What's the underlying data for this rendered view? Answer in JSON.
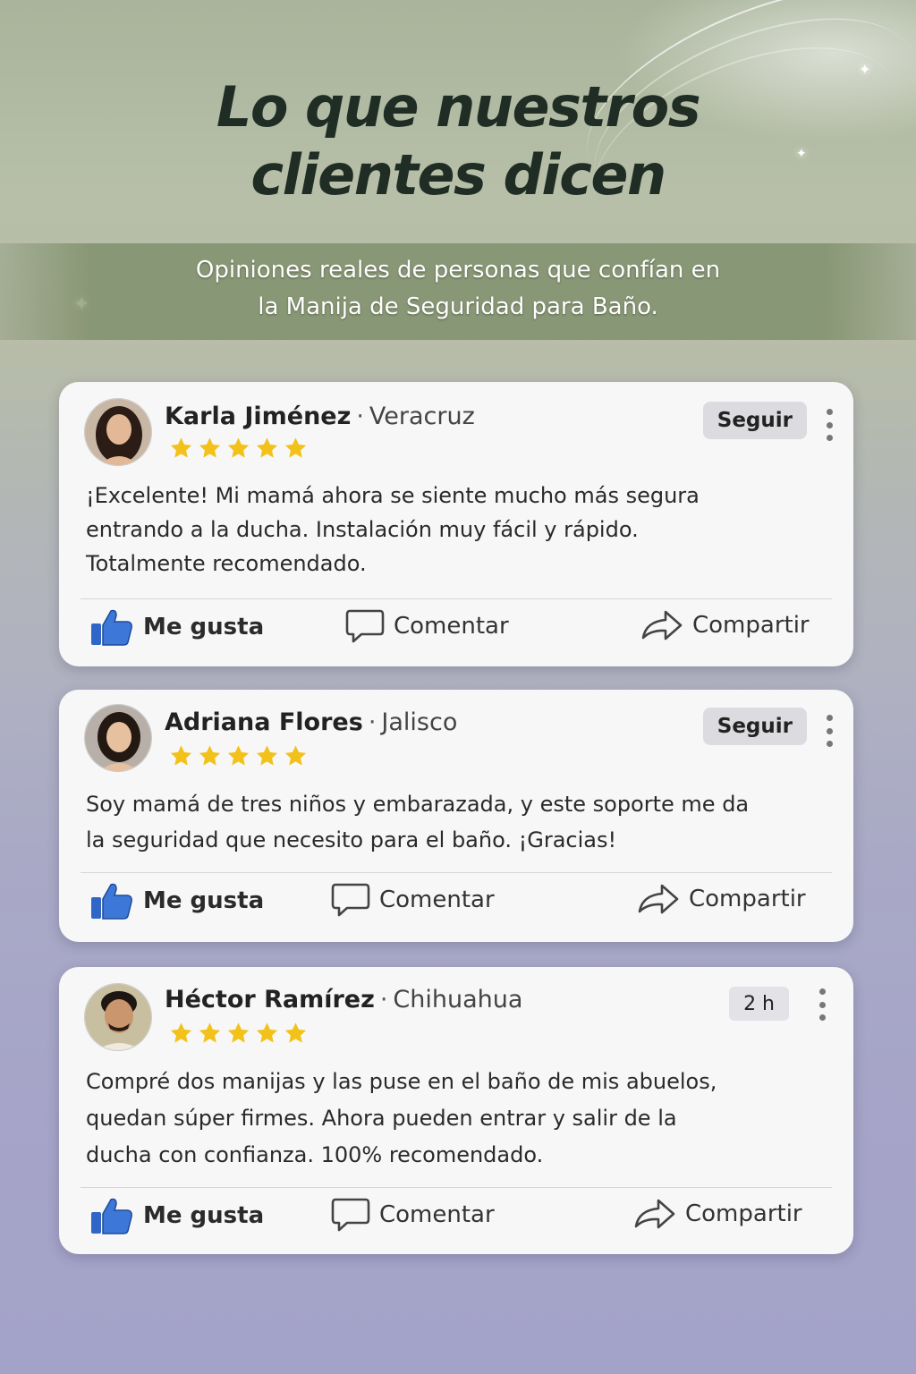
{
  "header": {
    "title_line1": "Lo que nuestros",
    "title_line2": "clientes dicen",
    "subtitle_line1": "Opiniones reales de personas que confían en",
    "subtitle_line2": "la Manija de Seguridad para Baño."
  },
  "separator": "·",
  "actions": {
    "like_label": "Me gusta",
    "comment_label": "Comentar",
    "share_label": "Compartir"
  },
  "reviews": [
    {
      "name": "Karla Jiménez",
      "location": "Veracruz",
      "rating": 5,
      "badge": "Seguir",
      "text_lines": [
        "¡Excelente! Mi mamá ahora se siente mucho más segura",
        "entrando a la ducha. Instalación muy fácil y rápido.",
        "Totalmente recomendado."
      ]
    },
    {
      "name": "Adriana Flores",
      "location": "Jalisco",
      "rating": 5,
      "badge": "Seguir",
      "text_lines": [
        "Soy mamá de tres niños y embarazada, y este soporte me da",
        "la seguridad que necesito para el baño. ¡Gracias!"
      ]
    },
    {
      "name": "Héctor Ramírez",
      "location": "Chihuahua",
      "rating": 5,
      "badge": "2 h",
      "text_lines": [
        "Compré dos manijas y las puse en el baño de mis abuelos,",
        "quedan súper firmes. Ahora pueden entrar y salir de la",
        "ducha con confianza. 100% recomendado."
      ]
    }
  ],
  "colors": {
    "star": "#f2c21b",
    "like_blue": "#2f66c8",
    "card_bg": "#f7f7f8",
    "title": "#1f2d25"
  },
  "icons": [
    "thumbs-up-icon",
    "speech-bubble-icon",
    "share-arrow-icon",
    "more-vertical-icon",
    "star-icon"
  ]
}
